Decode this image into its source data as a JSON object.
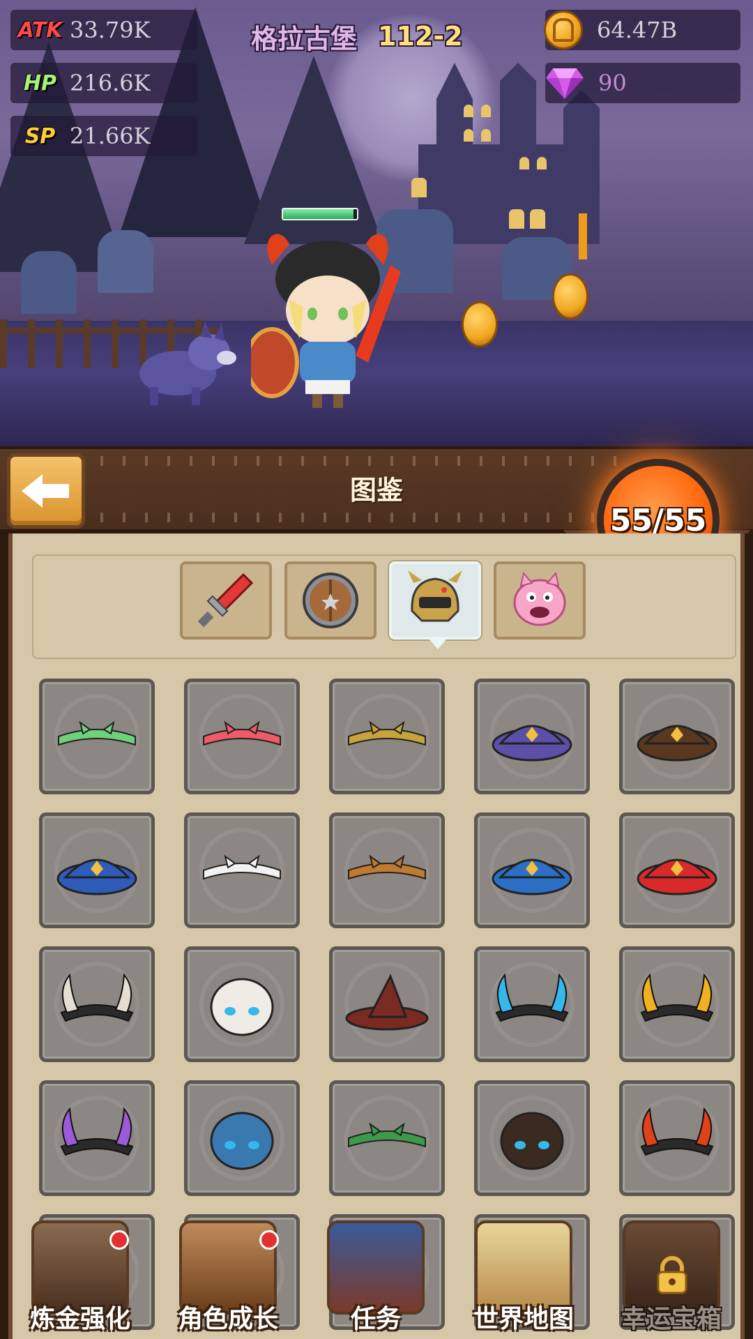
{
  "stats": [
    {
      "label": "ATK",
      "value": "33.79K"
    },
    {
      "label": "HP",
      "value": "216.6K"
    },
    {
      "label": "SP",
      "value": "21.66K"
    }
  ],
  "stage": {
    "name": "格拉古堡",
    "number": "112-2"
  },
  "currency": {
    "gold": "64.47B",
    "gems": "90"
  },
  "hero": {
    "hp_fraction": 0.95
  },
  "panel": {
    "title": "图鉴",
    "furnace_count": "55/55"
  },
  "categories": [
    {
      "name": "weapon",
      "icon": "sword-icon"
    },
    {
      "name": "shield",
      "icon": "shield-icon"
    },
    {
      "name": "helmet",
      "icon": "helmet-icon",
      "active": true
    },
    {
      "name": "pet",
      "icon": "pig-icon"
    }
  ],
  "helmets": [
    {
      "icon": "green-bandana-icon",
      "color": "#6fd27a"
    },
    {
      "icon": "red-bandana-icon",
      "color": "#ef5b68"
    },
    {
      "icon": "feather-headband-icon",
      "color": "#c7a43a"
    },
    {
      "icon": "purple-cap-icon",
      "color": "#5b4fa8"
    },
    {
      "icon": "brown-cap-icon",
      "color": "#5a3820"
    },
    {
      "icon": "blue-feather-cap-icon",
      "color": "#2e5cb8"
    },
    {
      "icon": "wing-headband-icon",
      "color": "#f2f2f2"
    },
    {
      "icon": "owl-mask-icon",
      "color": "#c07a32"
    },
    {
      "icon": "navy-tricorn-icon",
      "color": "#2c6fc4"
    },
    {
      "icon": "red-crown-icon",
      "color": "#d82a2a"
    },
    {
      "icon": "horned-skull-icon",
      "color": "#e6ded0"
    },
    {
      "icon": "mummy-head-icon",
      "color": "#efece6"
    },
    {
      "icon": "witch-hat-icon",
      "color": "#7a2a22"
    },
    {
      "icon": "blue-horn-band-icon",
      "color": "#35b8ec"
    },
    {
      "icon": "gold-horn-band-icon",
      "color": "#f0b020"
    },
    {
      "icon": "purple-visor-icon",
      "color": "#9b5ad8"
    },
    {
      "icon": "cyclops-helm-icon",
      "color": "#3a78b0"
    },
    {
      "icon": "vine-wreath-icon",
      "color": "#3e9a4a"
    },
    {
      "icon": "hooded-cage-icon",
      "color": "#3a2a20"
    },
    {
      "icon": "demon-horn-helm-icon",
      "color": "#e0401a"
    }
  ],
  "nav": [
    {
      "label": "炼金强化",
      "icon": "alchemy-icon",
      "badge": true
    },
    {
      "label": "角色成长",
      "icon": "character-icon",
      "badge": true
    },
    {
      "label": "任务",
      "icon": "quest-book-icon",
      "badge": false
    },
    {
      "label": "世界地图",
      "icon": "world-map-icon",
      "badge": false
    },
    {
      "label": "幸运宝箱",
      "icon": "treasure-chest-icon",
      "badge": false,
      "locked": true
    }
  ]
}
